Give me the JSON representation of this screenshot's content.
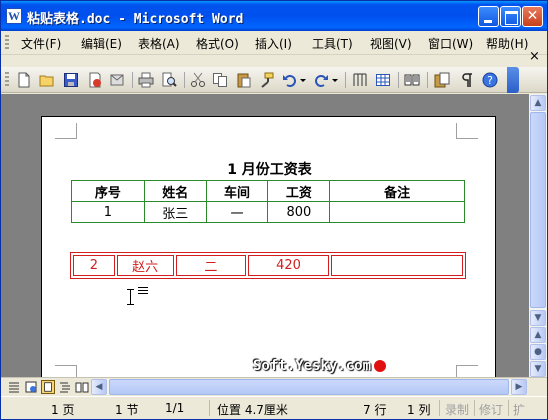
{
  "window": {
    "title": "粘贴表格.doc - Microsoft Word",
    "app_icon": "word-doc-icon"
  },
  "menu": {
    "items": [
      "文件(F)",
      "编辑(E)",
      "表格(A)",
      "格式(O)",
      "插入(I)",
      "工具(T)",
      "视图(V)",
      "窗口(W)",
      "帮助(H)"
    ],
    "close": "×"
  },
  "toolbar": {
    "icons": [
      "new-icon",
      "open-icon",
      "save-icon",
      "permission-icon",
      "email-icon",
      "print-icon",
      "print-preview-icon",
      "cut-icon",
      "copy-icon",
      "paste-icon",
      "format-painter-icon",
      "undo-icon",
      "redo-icon",
      "columns-icon",
      "table-icon",
      "read-icon",
      "research-icon",
      "show-hide-icon",
      "help-icon"
    ]
  },
  "document": {
    "title": "1 月份工资表",
    "table": {
      "headers": [
        "序号",
        "姓名",
        "车间",
        "工资",
        "备注"
      ],
      "rows": [
        [
          "1",
          "张三",
          "一",
          "800",
          ""
        ]
      ]
    },
    "pasted_row": [
      "2",
      "赵六",
      "二",
      "420",
      ""
    ],
    "watermark": "Soft.Yesky.com"
  },
  "status": {
    "page": "1 页",
    "section": "1 节",
    "page_of": "1/1",
    "position": "位置 4.7厘米",
    "line": "7 行",
    "column": "1 列",
    "rec": "录制",
    "trk": "修订",
    "ext": "扩"
  },
  "colors": {
    "table_border": "#2a8a2a",
    "pasted_red": "#d21e1e",
    "title_bar": "#0053ee"
  }
}
